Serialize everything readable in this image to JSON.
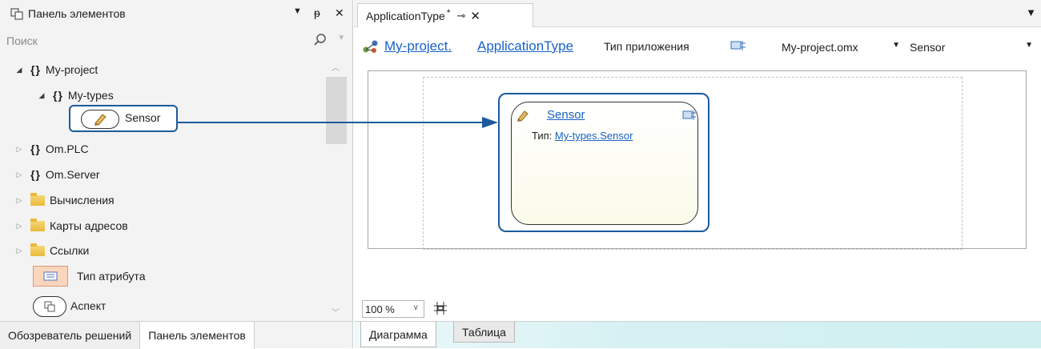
{
  "left_panel": {
    "title": "Панель элементов",
    "controls": {
      "dropdown": "▼",
      "pin": "ᵽ",
      "close": "✕"
    },
    "search_placeholder": "Поиск",
    "tree": {
      "my_project": "My-project",
      "my_types": "My-types",
      "sensor": "Sensor",
      "om_plc": "Om.PLC",
      "om_server": "Om.Server",
      "folder_calc": "Вычисления",
      "folder_maps": "Карты адресов",
      "folder_links": "Ссылки",
      "attr_type": "Тип атрибута",
      "aspect": "Аспект"
    },
    "bottom_tabs": [
      "Обозреватель решений",
      "Панель элементов"
    ]
  },
  "document": {
    "tab_label": "ApplicationType",
    "tab_modified": "*",
    "breadcrumb_project": "My-project.",
    "breadcrumb_type": "ApplicationType",
    "type_label": "Тип приложения",
    "file_select": "My-project.omx",
    "element_select": "Sensor",
    "node": {
      "name": "Sensor",
      "type_prefix": "Тип:",
      "type_link": "My-types.Sensor"
    },
    "zoom": "100 %",
    "bottom_tabs": [
      "Диаграмма",
      "Таблица"
    ]
  },
  "colors": {
    "selection_border": "#1d5a9c",
    "link": "#1a62c7",
    "attr_fill": "#fbd6bd"
  }
}
